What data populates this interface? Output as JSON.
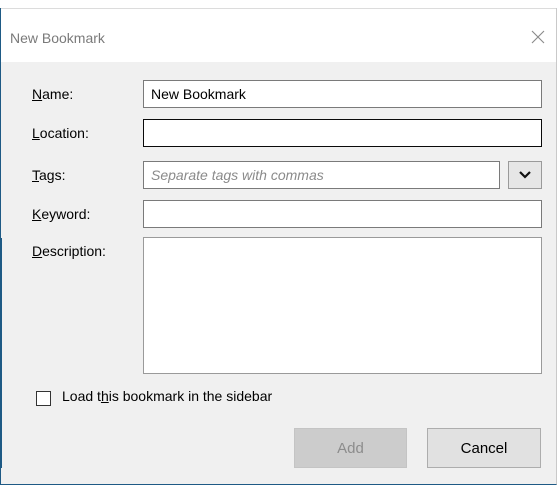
{
  "dialog": {
    "title": "New Bookmark",
    "close_icon": "close-icon"
  },
  "form": {
    "name": {
      "label_ul": "N",
      "label_rest": "ame:",
      "value": "New Bookmark"
    },
    "location": {
      "label_ul": "L",
      "label_rest": "ocation:",
      "value": ""
    },
    "tags": {
      "label_ul": "T",
      "label_rest": "ags:",
      "placeholder": "Separate tags with commas",
      "value": "",
      "dropdown_icon": "chevron-down-icon"
    },
    "keyword": {
      "label_ul": "K",
      "label_rest": "eyword:",
      "value": ""
    },
    "description": {
      "label_ul": "D",
      "label_rest": "escription:",
      "value": ""
    },
    "sidebar_checkbox": {
      "label_pre": "Load t",
      "label_ul": "h",
      "label_post": "is bookmark in the sidebar",
      "checked": false
    }
  },
  "buttons": {
    "add_label": "Add",
    "add_enabled": false,
    "cancel_label": "Cancel"
  }
}
